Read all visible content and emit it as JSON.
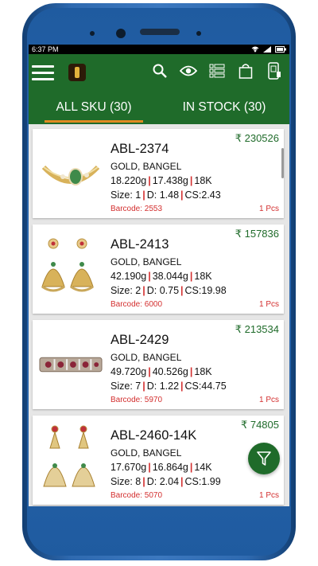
{
  "status": {
    "time": "6:37 PM"
  },
  "tabs": [
    {
      "label": "ALL SKU (30)"
    },
    {
      "label": "IN STOCK (30)"
    }
  ],
  "products": [
    {
      "sku": "ABL-2374",
      "category": "GOLD, BANGEL",
      "gross_weight": "18.220g",
      "net_weight": "17.438g",
      "purity": "18K",
      "size": "Size: 1",
      "diamond": "D: 1.48",
      "cs": "CS:2.43",
      "price": "₹ 230526",
      "barcode": "Barcode: 2553",
      "qty": "1 Pcs"
    },
    {
      "sku": "ABL-2413",
      "category": "GOLD, BANGEL",
      "gross_weight": "42.190g",
      "net_weight": "38.044g",
      "purity": "18K",
      "size": "Size: 2",
      "diamond": "D: 0.75",
      "cs": "CS:19.98",
      "price": "₹ 157836",
      "barcode": "Barcode: 6000",
      "qty": "1 Pcs"
    },
    {
      "sku": "ABL-2429",
      "category": "GOLD, BANGEL",
      "gross_weight": "49.720g",
      "net_weight": "40.526g",
      "purity": "18K",
      "size": "Size: 7",
      "diamond": "D: 1.22",
      "cs": "CS:44.75",
      "price": "₹ 213534",
      "barcode": "Barcode: 5970",
      "qty": "1 Pcs"
    },
    {
      "sku": "ABL-2460-14K",
      "category": "GOLD, BANGEL",
      "gross_weight": "17.670g",
      "net_weight": "16.864g",
      "purity": "14K",
      "size": "Size: 8",
      "diamond": "D: 2.04",
      "cs": "CS:1.99",
      "price": "₹ 74805",
      "barcode": "Barcode: 5070",
      "qty": "1 Pcs"
    }
  ],
  "colors": {
    "primary": "#1f6b2a",
    "accent": "#e08a21",
    "alert": "#d32f2f",
    "phone": "#2f6ab0"
  }
}
